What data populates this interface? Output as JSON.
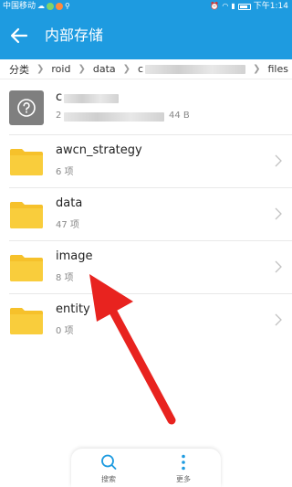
{
  "status_bar": {
    "carrier": "中国移动",
    "time": "下午1:14"
  },
  "app_bar": {
    "title": "内部存储",
    "back_icon": "arrow-left-icon"
  },
  "breadcrumb": {
    "items": [
      "分类",
      "roid",
      "data",
      "c",
      "files"
    ]
  },
  "files": [
    {
      "name": "c",
      "sub": "2",
      "size": "44 B",
      "icon": "unknown-file-icon",
      "redacted": true
    },
    {
      "name": "awcn_strategy",
      "sub": "6 项",
      "icon": "folder-icon"
    },
    {
      "name": "data",
      "sub": "47 项",
      "icon": "folder-icon"
    },
    {
      "name": "image",
      "sub": "8 项",
      "icon": "folder-icon"
    },
    {
      "name": "entity",
      "sub": "0 项",
      "icon": "folder-icon"
    }
  ],
  "bottom_bar": {
    "search_label": "搜索",
    "more_label": "更多"
  },
  "colors": {
    "accent": "#1e9be0",
    "folder": "#f6c12b",
    "annotation_arrow": "#e8231f"
  }
}
